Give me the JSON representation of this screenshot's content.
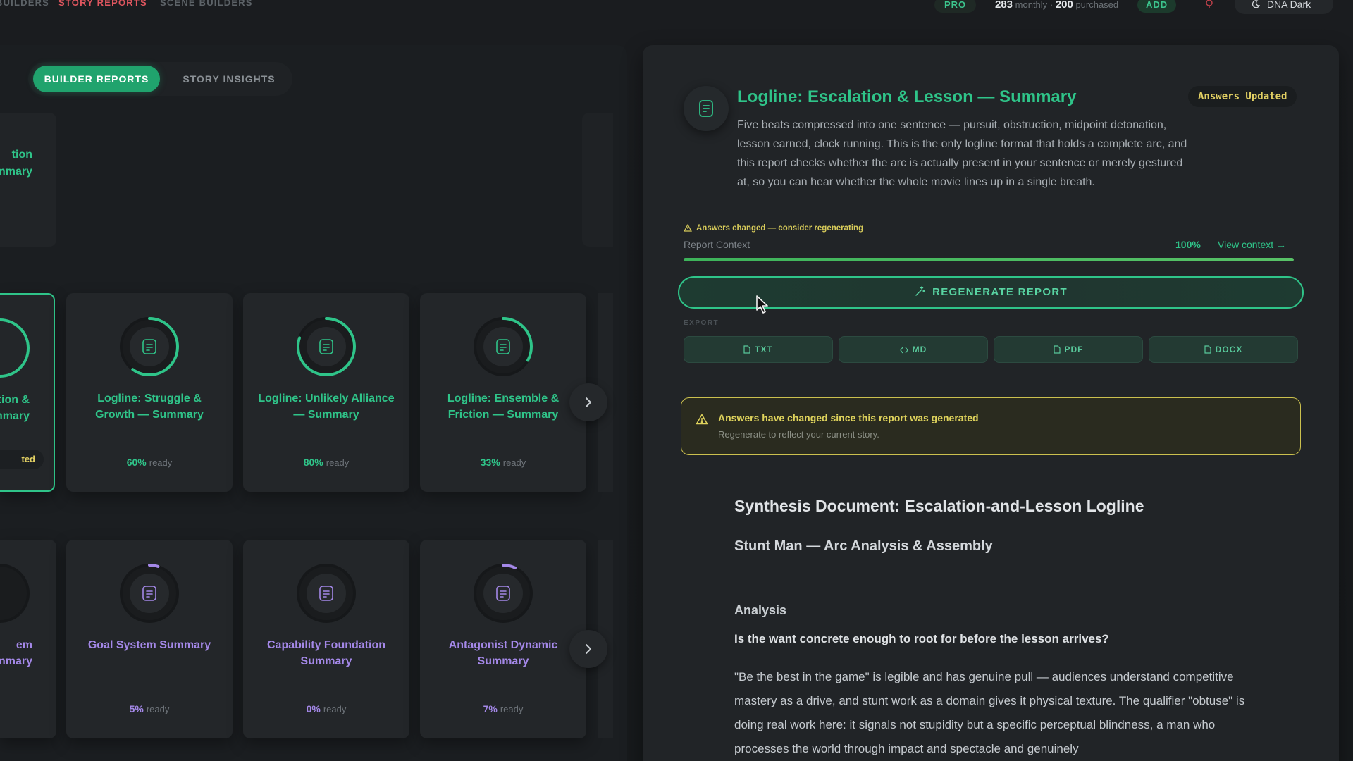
{
  "nav": {
    "links": [
      "BUILDERS",
      "STORY REPORTS",
      "SCENE BUILDERS"
    ],
    "pro_label": "PRO",
    "monthly_count": "283",
    "monthly_label": "monthly",
    "separator": "·",
    "purchased_count": "200",
    "purchased_label": "purchased",
    "add_label": "ADD",
    "theme_label": "DNA Dark"
  },
  "left": {
    "tabs": [
      {
        "label": "BUILDER REPORTS",
        "active": true
      },
      {
        "label": "STORY INSIGHTS",
        "active": false
      }
    ],
    "top_fragment_title": "tion\nmmary",
    "row1": {
      "partial": {
        "title": "tion &\nmmary",
        "badge": "ted"
      },
      "cards": [
        {
          "title": "Logline: Struggle & Growth — Summary",
          "percent": "60%",
          "ready_label": "ready",
          "progress": 0.6
        },
        {
          "title": "Logline: Unlikely Alliance — Summary",
          "percent": "80%",
          "ready_label": "ready",
          "progress": 0.8
        },
        {
          "title": "Logline: Ensemble & Friction — Summary",
          "percent": "33%",
          "ready_label": "ready",
          "progress": 0.33
        }
      ]
    },
    "row2": {
      "partial": {
        "title": "em\nmmary"
      },
      "cards": [
        {
          "title": "Goal System Summary",
          "percent": "5%",
          "ready_label": "ready",
          "progress": 0.05
        },
        {
          "title": "Capability Foundation Summary",
          "percent": "0%",
          "ready_label": "ready",
          "progress": 0.0
        },
        {
          "title": "Antagonist Dynamic Summary",
          "percent": "7%",
          "ready_label": "ready",
          "progress": 0.07
        }
      ]
    },
    "colors": {
      "green": "#2fc489",
      "purple": "#a488e8",
      "track": "#16181a"
    }
  },
  "report": {
    "title": "Logline: Escalation & Lesson — Summary",
    "status_badge": "Answers Updated",
    "description": "Five beats compressed into one sentence — pursuit, obstruction, midpoint detonation, lesson earned, clock running. This is the only logline format that holds a complete arc, and this report checks whether the arc is actually present in your sentence or merely gestured at, so you can hear whether the whole movie lines up in a single breath.",
    "warning": "Answers changed — consider regenerating",
    "context_label": "Report Context",
    "context_percent": "100%",
    "context_progress": 1.0,
    "view_context": "View context →",
    "regenerate_label": "REGENERATE REPORT",
    "export_label": "EXPORT",
    "export_buttons": [
      "TXT",
      "MD",
      "PDF",
      "DOCX"
    ],
    "alert_title": "Answers have changed since this report was generated",
    "alert_sub": "Regenerate to reflect your current story.",
    "doc": {
      "h1": "Synthesis Document: Escalation-and-Lesson Logline",
      "h2": "Stunt Man — Arc Analysis & Assembly",
      "h3": "Analysis",
      "question": "Is the want concrete enough to root for before the lesson arrives?",
      "paragraph": "\"Be the best in the game\" is legible and has genuine pull — audiences understand competitive mastery as a drive, and stunt work as a domain gives it physical texture. The qualifier \"obtuse\" is doing real work here: it signals not stupidity but a specific perceptual blindness, a man who processes the world through impact and spectacle and genuinely"
    }
  }
}
